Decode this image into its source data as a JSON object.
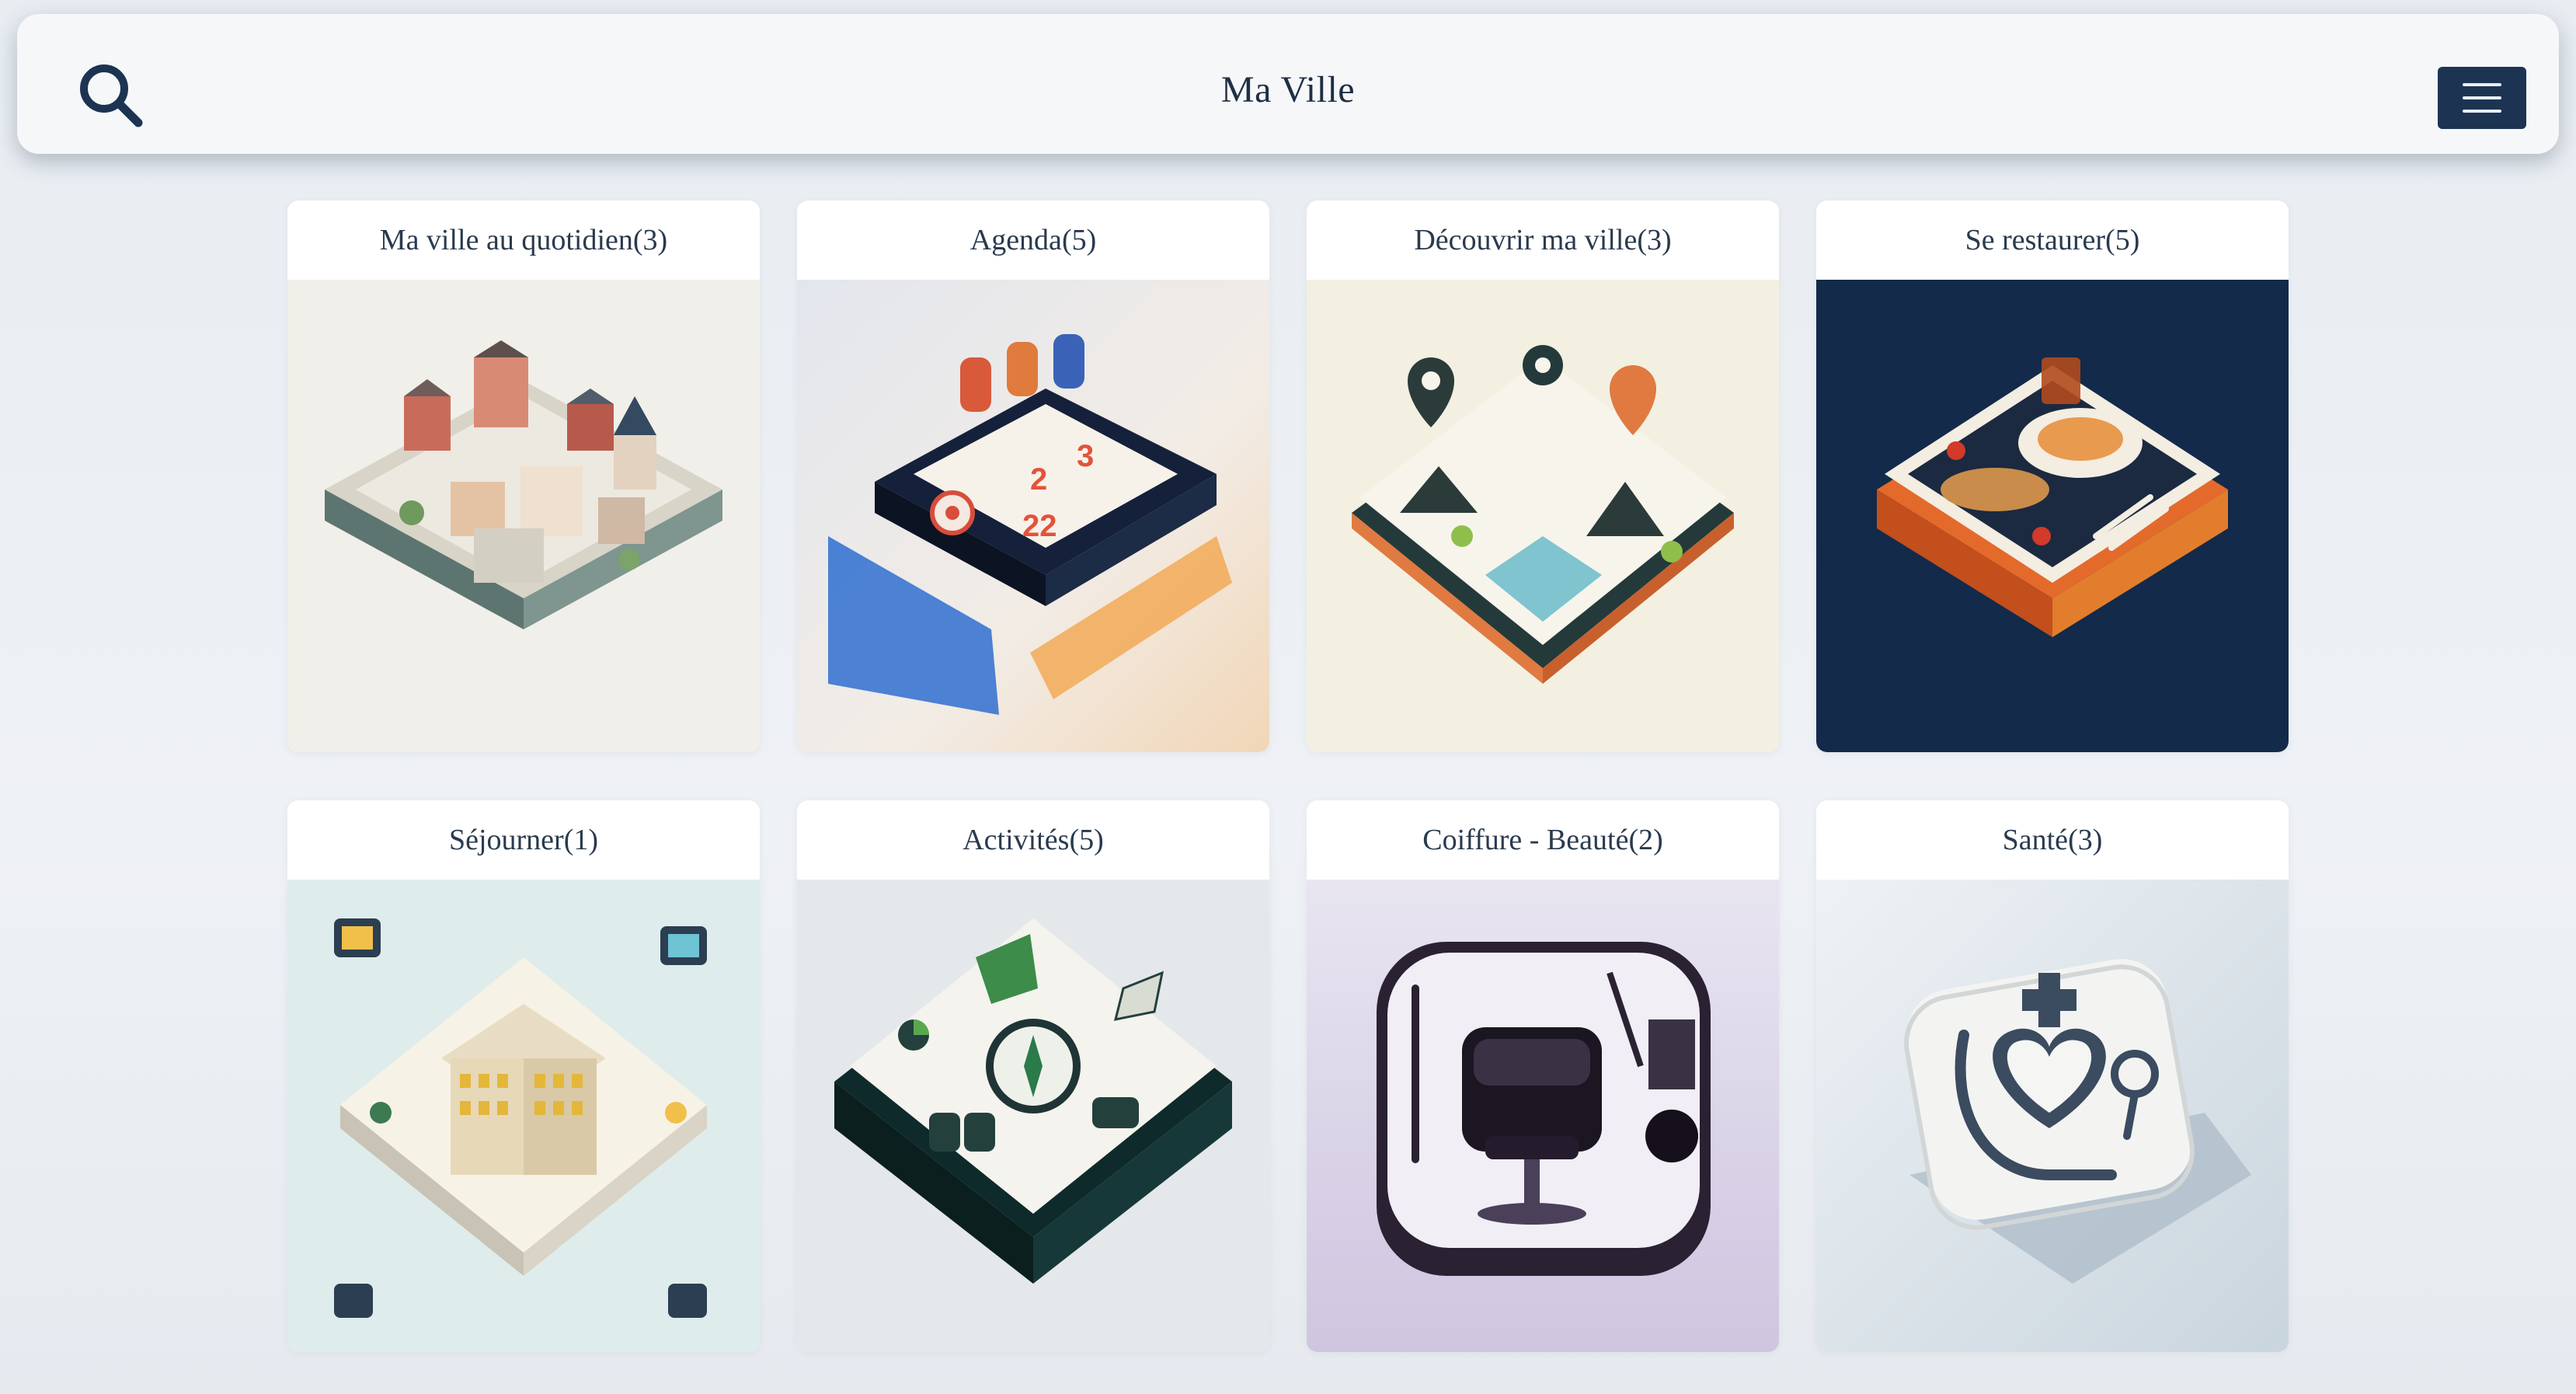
{
  "header": {
    "title": "Ma Ville",
    "search_icon": "search-icon",
    "menu_icon": "hamburger-menu-icon",
    "accent_color": "#1c3452"
  },
  "categories": [
    {
      "label": "Ma ville au quotidien",
      "count": "(3)",
      "icon": "isometric-town-icon",
      "bg": "#f1efe9"
    },
    {
      "label": "Agenda",
      "count": "(5)",
      "icon": "calendar-icon",
      "bg": "#e9ecf3"
    },
    {
      "label": "Découvrir ma ville",
      "count": "(3)",
      "icon": "map-pin-icon",
      "bg": "#f3f0e1"
    },
    {
      "label": "Se restaurer",
      "count": "(5)",
      "icon": "food-plate-icon",
      "bg": "#132a4a"
    },
    {
      "label": "Séjourner",
      "count": "(1)",
      "icon": "hotel-icon",
      "bg": "#dfecec"
    },
    {
      "label": "Activités",
      "count": "(5)",
      "icon": "compass-activities-icon",
      "bg": "#e4e8ea"
    },
    {
      "label": "Coiffure - Beauté",
      "count": "(2)",
      "icon": "barber-chair-icon",
      "bg": "#e6e2ef"
    },
    {
      "label": "Santé",
      "count": "(3)",
      "icon": "stethoscope-heart-icon",
      "bg": "#dce4ea"
    }
  ]
}
